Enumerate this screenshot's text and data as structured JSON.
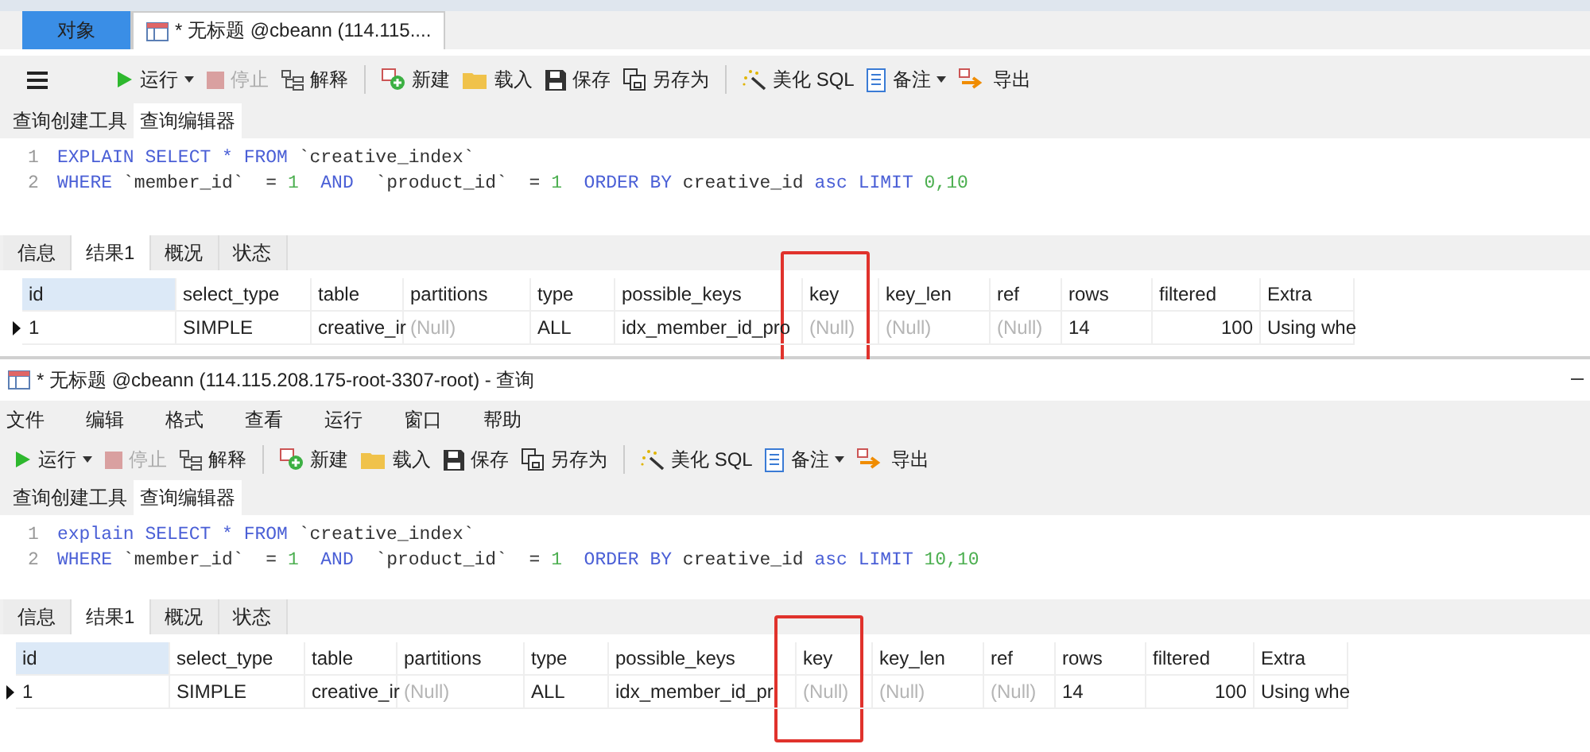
{
  "panels": [
    {
      "doc_tabs": [
        {
          "label": "对象",
          "kind": "objects",
          "selected": false
        },
        {
          "label": "* 无标题 @cbeann (114.115....",
          "kind": "query",
          "selected": true
        }
      ],
      "menu_button": true,
      "toolbar": [
        {
          "kind": "run",
          "label": "运行",
          "dropdown": true,
          "disabled": false
        },
        {
          "kind": "stop",
          "label": "停止",
          "dropdown": false,
          "disabled": true
        },
        {
          "kind": "explain",
          "label": "解释",
          "dropdown": false,
          "disabled": false,
          "separator_after": true
        },
        {
          "kind": "new",
          "label": "新建",
          "dropdown": false,
          "disabled": false
        },
        {
          "kind": "load",
          "label": "载入",
          "dropdown": false,
          "disabled": false
        },
        {
          "kind": "save",
          "label": "保存",
          "dropdown": false,
          "disabled": false
        },
        {
          "kind": "saveas",
          "label": "另存为",
          "dropdown": false,
          "disabled": false,
          "separator_after": true
        },
        {
          "kind": "beautify",
          "label": "美化 SQL",
          "dropdown": false,
          "disabled": false
        },
        {
          "kind": "note",
          "label": "备注",
          "dropdown": true,
          "disabled": false
        },
        {
          "kind": "export",
          "label": "导出",
          "dropdown": false,
          "disabled": false
        }
      ],
      "editor_tabs": [
        {
          "label": "查询创建工具",
          "selected": false
        },
        {
          "label": "查询编辑器",
          "selected": true
        }
      ],
      "code": [
        {
          "number": "1",
          "tokens": [
            {
              "kind": "keyword",
              "text": "EXPLAIN SELECT * FROM"
            },
            {
              "kind": "plain",
              "text": " `creative_index`"
            }
          ]
        },
        {
          "number": "2",
          "tokens": [
            {
              "kind": "keyword",
              "text": "WHERE"
            },
            {
              "kind": "plain",
              "text": " `member_id`  = "
            },
            {
              "kind": "number",
              "text": "1"
            },
            {
              "kind": "keyword",
              "text": "  AND"
            },
            {
              "kind": "plain",
              "text": "  `product_id`  = "
            },
            {
              "kind": "number",
              "text": "1"
            },
            {
              "kind": "keyword",
              "text": "  ORDER BY"
            },
            {
              "kind": "plain",
              "text": " creative_id"
            },
            {
              "kind": "keyword",
              "text": " asc LIMIT"
            },
            {
              "kind": "number",
              "text": " 0,10"
            }
          ]
        }
      ],
      "result_tabs": [
        {
          "label": "信息",
          "selected": false
        },
        {
          "label": "结果1",
          "selected": true
        },
        {
          "label": "概况",
          "selected": false
        },
        {
          "label": "状态",
          "selected": false
        }
      ],
      "columns": [
        {
          "label": "id",
          "selected": true,
          "highlighted": false
        },
        {
          "label": "select_type",
          "selected": false,
          "highlighted": false
        },
        {
          "label": "table",
          "selected": false,
          "highlighted": false
        },
        {
          "label": "partitions",
          "selected": false,
          "highlighted": false
        },
        {
          "label": "type",
          "selected": false,
          "highlighted": false
        },
        {
          "label": "possible_keys",
          "selected": false,
          "highlighted": false
        },
        {
          "label": "key",
          "selected": false,
          "highlighted": true
        },
        {
          "label": "key_len",
          "selected": false,
          "highlighted": false
        },
        {
          "label": "ref",
          "selected": false,
          "highlighted": false
        },
        {
          "label": "rows",
          "selected": false,
          "highlighted": false
        },
        {
          "label": "filtered",
          "selected": false,
          "highlighted": false
        },
        {
          "label": "Extra",
          "selected": false,
          "highlighted": false
        }
      ],
      "rows": [
        {
          "current": true,
          "cells": [
            {
              "kind": "text",
              "text": "1"
            },
            {
              "kind": "text",
              "text": "SIMPLE"
            },
            {
              "kind": "text",
              "text": "creative_ir"
            },
            {
              "kind": "null",
              "text": "(Null)"
            },
            {
              "kind": "text",
              "text": "ALL"
            },
            {
              "kind": "text",
              "text": "idx_member_id_pro"
            },
            {
              "kind": "null",
              "text": "(Null)"
            },
            {
              "kind": "null",
              "text": "(Null)"
            },
            {
              "kind": "null",
              "text": "(Null)"
            },
            {
              "kind": "text",
              "text": "14"
            },
            {
              "kind": "number",
              "text": "100"
            },
            {
              "kind": "text",
              "text": "Using whe"
            }
          ]
        }
      ]
    },
    {
      "title": "* 无标题 @cbeann (114.115.208.175-root-3307-root) - 查询",
      "menu": [
        "文件",
        "编辑",
        "格式",
        "查看",
        "运行",
        "窗口",
        "帮助"
      ],
      "toolbar": [
        {
          "kind": "run",
          "label": "运行",
          "dropdown": true,
          "disabled": false
        },
        {
          "kind": "stop",
          "label": "停止",
          "dropdown": false,
          "disabled": true
        },
        {
          "kind": "explain",
          "label": "解释",
          "dropdown": false,
          "disabled": false,
          "separator_after": true
        },
        {
          "kind": "new",
          "label": "新建",
          "dropdown": false,
          "disabled": false
        },
        {
          "kind": "load",
          "label": "载入",
          "dropdown": false,
          "disabled": false
        },
        {
          "kind": "save",
          "label": "保存",
          "dropdown": false,
          "disabled": false
        },
        {
          "kind": "saveas",
          "label": "另存为",
          "dropdown": false,
          "disabled": false,
          "separator_after": true
        },
        {
          "kind": "beautify",
          "label": "美化 SQL",
          "dropdown": false,
          "disabled": false
        },
        {
          "kind": "note",
          "label": "备注",
          "dropdown": true,
          "disabled": false
        },
        {
          "kind": "export",
          "label": "导出",
          "dropdown": false,
          "disabled": false
        }
      ],
      "editor_tabs": [
        {
          "label": "查询创建工具",
          "selected": false
        },
        {
          "label": "查询编辑器",
          "selected": true
        }
      ],
      "code": [
        {
          "number": "1",
          "tokens": [
            {
              "kind": "keyword",
              "text": "explain SELECT * FROM"
            },
            {
              "kind": "plain",
              "text": " `creative_index`"
            }
          ]
        },
        {
          "number": "2",
          "tokens": [
            {
              "kind": "keyword",
              "text": "WHERE"
            },
            {
              "kind": "plain",
              "text": " `member_id`  = "
            },
            {
              "kind": "number",
              "text": "1"
            },
            {
              "kind": "keyword",
              "text": "  AND"
            },
            {
              "kind": "plain",
              "text": "  `product_id`  = "
            },
            {
              "kind": "number",
              "text": "1"
            },
            {
              "kind": "keyword",
              "text": "  ORDER BY"
            },
            {
              "kind": "plain",
              "text": " creative_id"
            },
            {
              "kind": "keyword",
              "text": " asc LIMIT"
            },
            {
              "kind": "number",
              "text": " 10,10"
            }
          ]
        }
      ],
      "result_tabs": [
        {
          "label": "信息",
          "selected": false
        },
        {
          "label": "结果1",
          "selected": true
        },
        {
          "label": "概况",
          "selected": false
        },
        {
          "label": "状态",
          "selected": false
        }
      ],
      "columns": [
        {
          "label": "id",
          "selected": true,
          "highlighted": false
        },
        {
          "label": "select_type",
          "selected": false,
          "highlighted": false
        },
        {
          "label": "table",
          "selected": false,
          "highlighted": false
        },
        {
          "label": "partitions",
          "selected": false,
          "highlighted": false
        },
        {
          "label": "type",
          "selected": false,
          "highlighted": false
        },
        {
          "label": "possible_keys",
          "selected": false,
          "highlighted": false
        },
        {
          "label": "key",
          "selected": false,
          "highlighted": true
        },
        {
          "label": "key_len",
          "selected": false,
          "highlighted": false
        },
        {
          "label": "ref",
          "selected": false,
          "highlighted": false
        },
        {
          "label": "rows",
          "selected": false,
          "highlighted": false
        },
        {
          "label": "filtered",
          "selected": false,
          "highlighted": false
        },
        {
          "label": "Extra",
          "selected": false,
          "highlighted": false
        }
      ],
      "rows": [
        {
          "current": true,
          "cells": [
            {
              "kind": "text",
              "text": "1"
            },
            {
              "kind": "text",
              "text": "SIMPLE"
            },
            {
              "kind": "text",
              "text": "creative_ir"
            },
            {
              "kind": "null",
              "text": "(Null)"
            },
            {
              "kind": "text",
              "text": "ALL"
            },
            {
              "kind": "text",
              "text": "idx_member_id_pr"
            },
            {
              "kind": "null",
              "text": "(Null)"
            },
            {
              "kind": "null",
              "text": "(Null)"
            },
            {
              "kind": "null",
              "text": "(Null)"
            },
            {
              "kind": "text",
              "text": "14"
            },
            {
              "kind": "number",
              "text": "100"
            },
            {
              "kind": "text",
              "text": "Using whe"
            }
          ]
        }
      ]
    }
  ]
}
